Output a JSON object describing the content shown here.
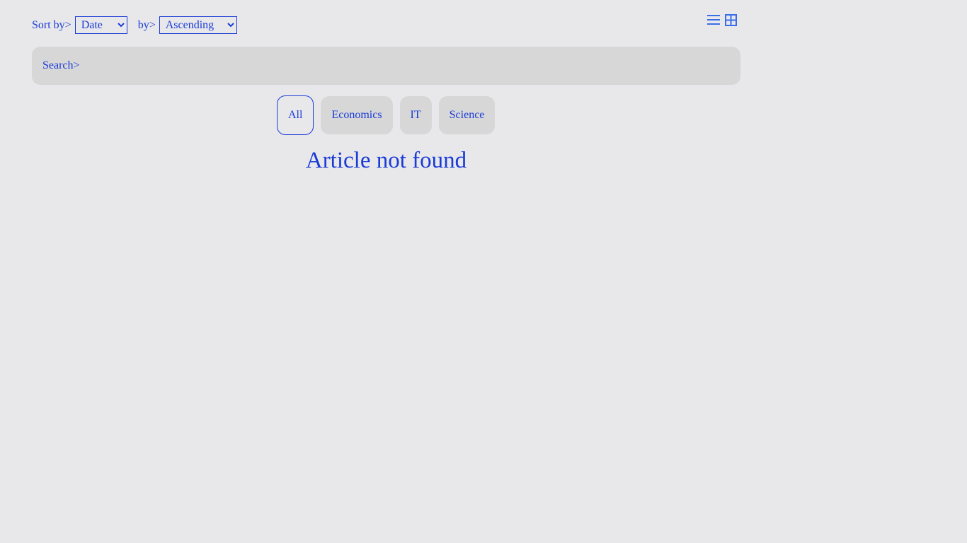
{
  "sort": {
    "label": "Sort by>",
    "field_selected": "Date",
    "order_label": "by>",
    "order_selected": "Ascending"
  },
  "view_toggle": {
    "list_icon": "list-icon",
    "grid_icon": "grid-icon"
  },
  "search": {
    "placeholder": "Search>"
  },
  "categories": {
    "items": [
      {
        "label": "All",
        "active": true
      },
      {
        "label": "Economics",
        "active": false
      },
      {
        "label": "IT",
        "active": false
      },
      {
        "label": "Science",
        "active": false
      }
    ]
  },
  "message": {
    "text": "Article not found"
  },
  "colors": {
    "accent": "#1a3bd6",
    "background": "#e8e8eb",
    "chip": "#d7d7d8"
  }
}
